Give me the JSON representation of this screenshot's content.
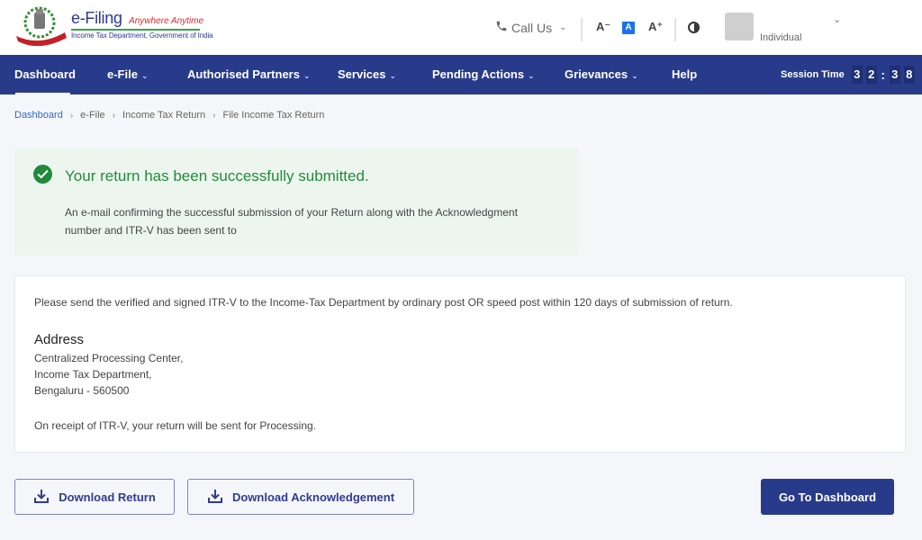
{
  "header": {
    "brand_title": "e-Filing",
    "brand_tagline": "Anywhere Anytime",
    "brand_subtitle": "Income Tax Department, Government of India",
    "call_us_label": "Call Us",
    "font_size_decrease": "A⁻",
    "font_size_default": "A",
    "font_size_increase": "A⁺",
    "user_type": "Individual",
    "colors": {
      "brand": "#2b3990",
      "tagline": "#d7282f",
      "accent_rule": "#3aa34a"
    }
  },
  "nav": {
    "items": [
      {
        "label": "Dashboard",
        "has_dropdown": false,
        "active": true
      },
      {
        "label": "e-File",
        "has_dropdown": true
      },
      {
        "label": "Authorised Partners",
        "has_dropdown": true
      },
      {
        "label": "Services",
        "has_dropdown": true
      },
      {
        "label": "Pending Actions",
        "has_dropdown": true
      },
      {
        "label": "Grievances",
        "has_dropdown": true
      },
      {
        "label": "Help",
        "has_dropdown": false
      }
    ],
    "caret": "⌄",
    "session_label": "Session Time",
    "session_digits": [
      "3",
      "2",
      "3",
      "8"
    ],
    "session_separator": ":",
    "colors": {
      "background": "#283b8a"
    }
  },
  "breadcrumb": {
    "items": [
      "Dashboard",
      "e-File",
      "Income Tax Return",
      "File Income Tax Return"
    ],
    "separator": "›"
  },
  "success": {
    "title": "Your return has been successfully submitted.",
    "body": "An e-mail confirming the successful submission of your Return along with the Acknowledgment number and ITR-V has been sent to",
    "colors": {
      "background": "#ecf6ee",
      "text": "#248a3c"
    }
  },
  "info": {
    "instruction": "Please send the verified and signed ITR-V to the Income-Tax Department by ordinary post OR speed post within 120 days of submission of return.",
    "address_heading": "Address",
    "address_lines": [
      "Centralized Processing Center,",
      "Income Tax Department,",
      "Bengaluru - 560500"
    ],
    "footer": "On receipt of ITR-V, your return will be sent for Processing."
  },
  "actions": {
    "download_return": "Download Return",
    "download_ack": "Download Acknowledgement",
    "go_dashboard": "Go To Dashboard"
  }
}
